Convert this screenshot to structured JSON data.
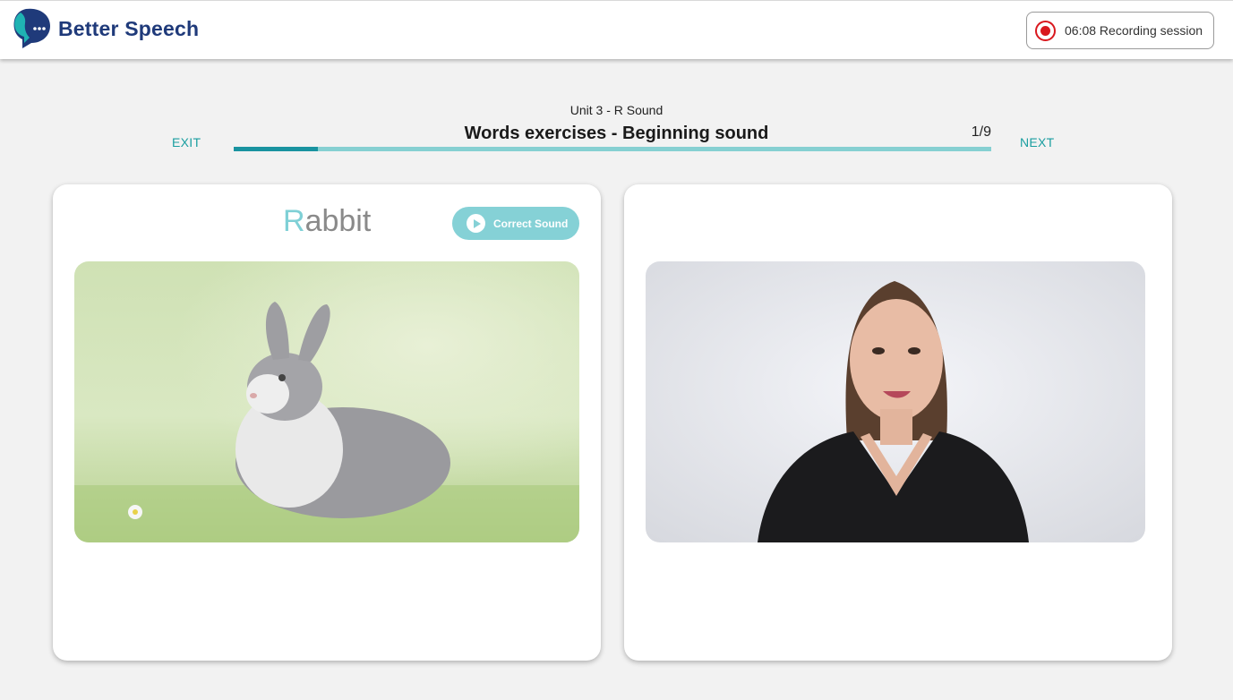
{
  "header": {
    "brand": "Better Speech",
    "recording_label": "06:08 Recording session"
  },
  "lesson": {
    "unit": "Unit 3 - R Sound",
    "title": "Words exercises - Beginning sound",
    "counter": "1/9",
    "progress": 0.111,
    "exit_label": "EXIT",
    "next_label": "NEXT"
  },
  "word_card": {
    "first_letter": "R",
    "rest": "abbit",
    "sound_button": "Correct Sound",
    "image": "rabbit-photo"
  },
  "video_card": {
    "image": "speech-therapist-video"
  },
  "colors": {
    "accent": "#1a9ea0",
    "brand": "#1f3a7a",
    "recording": "#d9181e",
    "sound_button": "#85d1d6"
  }
}
